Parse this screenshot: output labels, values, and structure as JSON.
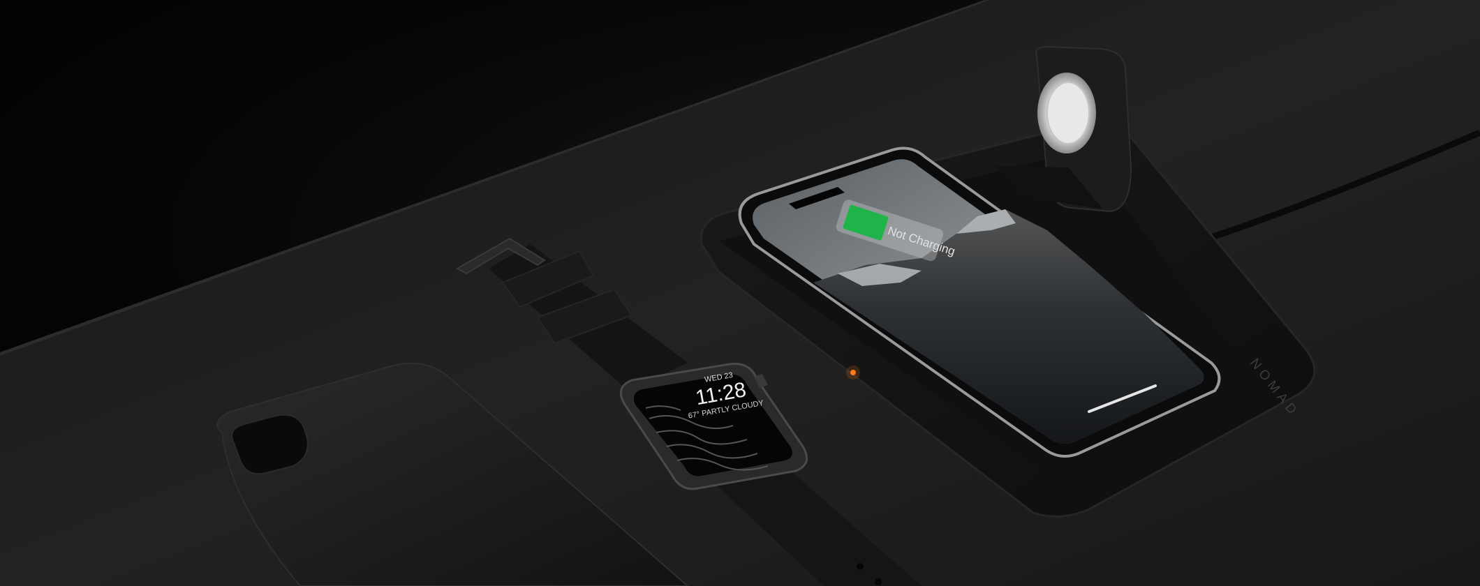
{
  "scene": {
    "watch": {
      "date": "WED 23",
      "time": "11:28",
      "weather": "67° PARTLY CLOUDY"
    },
    "phone": {
      "status": "Not Charging"
    },
    "charger": {
      "brand": "NOMAD"
    }
  },
  "colors": {
    "background": "#000000",
    "table": "#1c1c1c",
    "charge_indicator": "#1fb44a",
    "led": "#ff7a1a"
  }
}
